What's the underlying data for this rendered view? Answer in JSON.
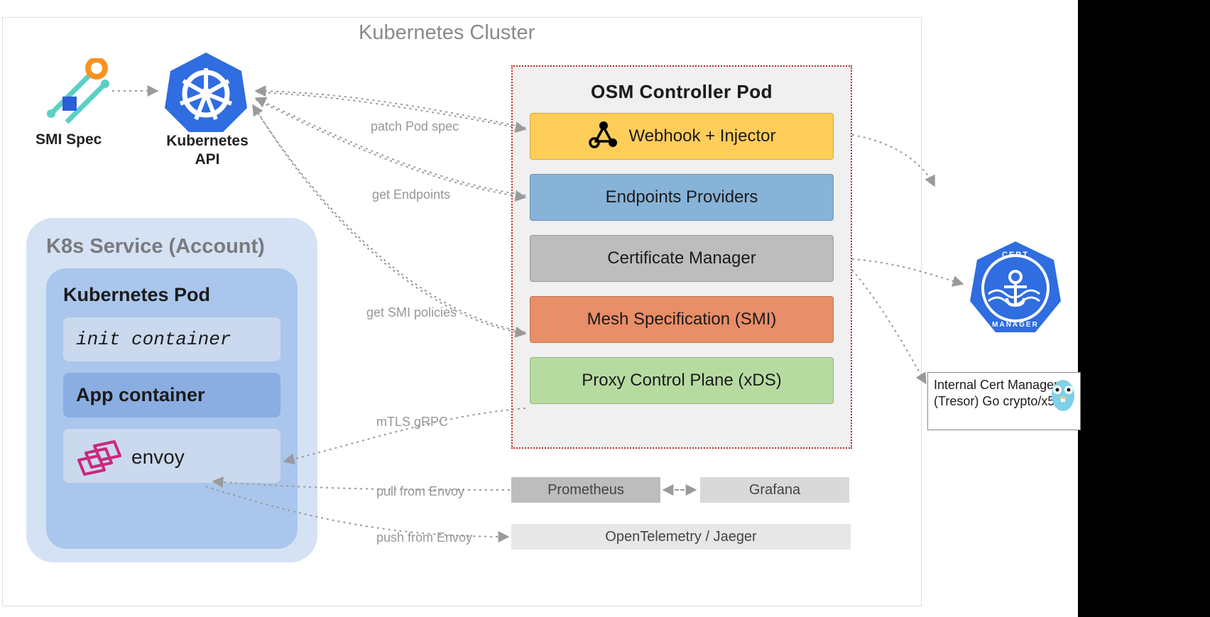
{
  "cluster": {
    "title": "Kubernetes Cluster"
  },
  "smi": {
    "label": "SMI Spec"
  },
  "k8s": {
    "label": "Kubernetes API"
  },
  "service": {
    "title": "K8s Service (Account)",
    "pod_title": "Kubernetes Pod",
    "init": "init container",
    "app": "App container",
    "envoy": "envoy"
  },
  "osm": {
    "title": "OSM Controller Pod",
    "webhook": "Webhook + Injector",
    "endpoints": "Endpoints Providers",
    "cert": "Certificate Manager",
    "smi_spec": "Mesh Specification (SMI)",
    "proxy": "Proxy Control Plane (xDS)"
  },
  "metrics": {
    "prometheus": "Prometheus",
    "grafana": "Grafana",
    "otel": "OpenTelemetry / Jaeger"
  },
  "edges": {
    "patch": "patch Pod spec",
    "get_ep": "get Endpoints",
    "get_smi": "get SMI policies",
    "mtls": "mTLS gRPC",
    "pull": "pull from Envoy",
    "push": "push from Envoy"
  },
  "external": {
    "internal_cert": "Internal Cert Manager (Tresor) Go crypto/x509"
  }
}
